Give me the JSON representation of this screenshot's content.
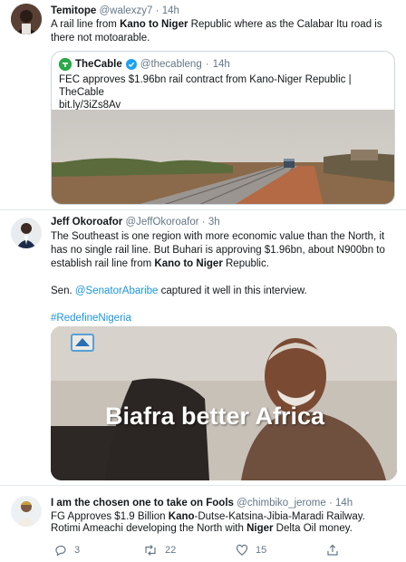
{
  "tweet1": {
    "name": "Temitope",
    "handle": "@walexzy7",
    "dot": "·",
    "time": "14h",
    "text_a": "A rail line from ",
    "text_bold": "Kano to Niger",
    "text_b": " Republic where as the Calabar Itu road is there not motoarable.",
    "quote": {
      "name": "TheCable",
      "handle": "@thecableng",
      "dot": "·",
      "time": "14h",
      "line1": "FEC approves $1.96bn rail contract from Kano-Niger Republic | TheCable",
      "line2": "bit.ly/3iZs8Av"
    }
  },
  "tweet2": {
    "name": "Jeff Okoroafor",
    "handle": "@JeffOkoroafor",
    "dot": "·",
    "time": "3h",
    "p1_a": "The Southeast is one region with more economic value than the North, it has no single rail line. But Buhari is approving $1.96bn, about N900bn to establish rail line from ",
    "p1_bold": "Kano to Niger",
    "p1_b": " Republic.",
    "p2_a": "Sen. ",
    "p2_mention": "@SenatorAbaribe",
    "p2_b": " captured it well in this interview.",
    "hashtag": "#RedefineNigeria",
    "video_caption": "Biafra better Africa"
  },
  "tweet3": {
    "name": "I am the chosen one to take on Fools",
    "handle": "@chimbiko_jerome",
    "dot": "·",
    "time": "14h",
    "l1_a": "FG Approves $1.9 Billion ",
    "l1_bold": "Kano",
    "l1_b": "-Dutse-Katsina-Jibia-Maradi Railway.",
    "l2_a": "Rotimi Ameachi developing the North with ",
    "l2_bold": "Niger",
    "l2_b": " Delta Oil money.",
    "replies": "3",
    "retweets": "22",
    "likes": "15"
  },
  "colors": {
    "link": "#1b95e0",
    "muted": "#657786",
    "border": "#e1e8ed",
    "verified": "#1da1f2"
  },
  "icons": [
    "reply-icon",
    "retweet-icon",
    "like-icon",
    "share-icon",
    "verified-badge-icon"
  ]
}
